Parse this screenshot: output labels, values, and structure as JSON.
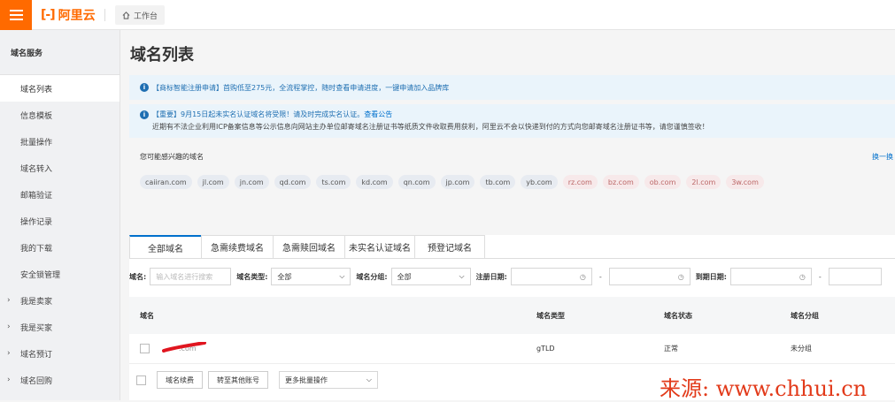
{
  "topbar": {
    "brand": "阿里云",
    "brand_mark": "[-]",
    "workbench": "工作台",
    "accent": "#ff6a00"
  },
  "sidebar": {
    "title": "域名服务",
    "items": [
      {
        "label": "域名列表"
      },
      {
        "label": "信息模板"
      },
      {
        "label": "批量操作"
      },
      {
        "label": "域名转入"
      },
      {
        "label": "邮箱验证"
      },
      {
        "label": "操作记录"
      },
      {
        "label": "我的下载"
      },
      {
        "label": "安全锁管理"
      }
    ],
    "groups": [
      {
        "label": "我是卖家"
      },
      {
        "label": "我是买家"
      },
      {
        "label": "域名预订"
      },
      {
        "label": "域名回购"
      }
    ]
  },
  "page": {
    "title": "域名列表"
  },
  "notices": {
    "n1": "【商标智能注册申请】首购低至275元，全流程掌控，随时查看申请进度，一键申请加入品牌库",
    "n2_line1": "【重要】9月15日起未实名认证域名将受限！请及时完成实名认证。",
    "n2_link": "查看公告",
    "n2_line2": "近期有不法企业利用ICP备案信息等公示信息向网站主办单位邮寄域名注册证书等纸质文件收取费用获利，阿里云不会以快递到付的方式向您邮寄域名注册证书等，请您谨慎签收！"
  },
  "suggest": {
    "title": "您可能感兴趣的域名",
    "refresh": "换一换",
    "chips": [
      "caiiran.com",
      "jl.com",
      "jn.com",
      "qd.com",
      "ts.com",
      "kd.com",
      "qn.com",
      "jp.com",
      "tb.com",
      "yb.com",
      "rz.com",
      "bz.com",
      "ob.com",
      "2l.com",
      "3w.com"
    ]
  },
  "tabs": [
    "全部域名",
    "急需续费域名",
    "急需赎回域名",
    "未实名认证域名",
    "预登记域名"
  ],
  "filters": {
    "domain_label": "域名:",
    "domain_placeholder": "输入域名进行搜索",
    "type_label": "域名类型:",
    "type_value": "全部",
    "group_label": "域名分组:",
    "group_value": "全部",
    "reg_label": "注册日期:",
    "exp_label": "到期日期:",
    "dash": "-"
  },
  "table": {
    "headers": [
      "域名",
      "域名类型",
      "域名状态",
      "域名分组"
    ],
    "rows": [
      {
        "domain": ".com",
        "type": "gTLD",
        "status": "正常",
        "group": "未分组"
      }
    ]
  },
  "bulk": {
    "renew": "域名续费",
    "transfer": "转至其他账号",
    "more": "更多批量操作"
  },
  "watermark": "来源: www.chhui.cn"
}
